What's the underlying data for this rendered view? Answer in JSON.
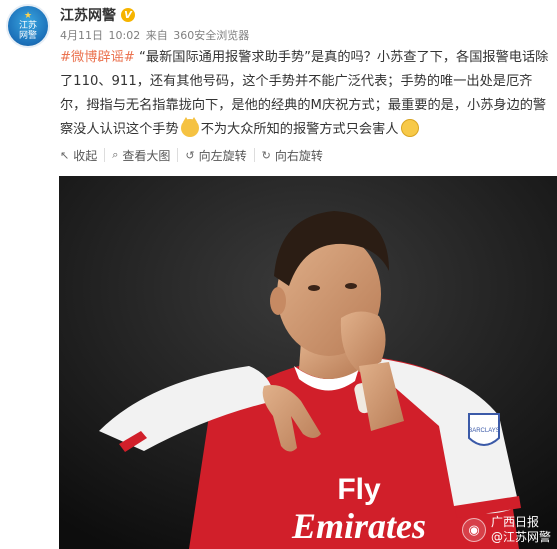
{
  "account": {
    "avatar_lines": [
      "江苏",
      "网警"
    ],
    "name": "江苏网警",
    "verified_mark": "V"
  },
  "meta": {
    "date": "4月11日",
    "time": "10:02",
    "via_prefix": "来自",
    "client": "360安全浏览器"
  },
  "post": {
    "hashtag": "#微博辟谣#",
    "text_1": " “最新国际通用报警求助手势”是真的吗？小苏查了下，各国报警电话除了110、911，还有其他号码，这个手势并不能广泛代表；手势的唯一出处是厄齐尔，拇指与无名指靠拢向下，是他的经典的M庆祝方式；最重要的是，小苏身边的警察没人认识这个手势",
    "text_2": "不为大众所知的报警方式只会害人",
    "emoji_1": "cat-face-emoji",
    "emoji_2": "thinking-emoji"
  },
  "toolbar": [
    {
      "icon": "↖",
      "label": "收起"
    },
    {
      "icon": "⌕",
      "label": "查看大图"
    },
    {
      "icon": "↺",
      "label": "向左旋转"
    },
    {
      "icon": "↻",
      "label": "向右旋转"
    }
  ],
  "photo": {
    "shirt_sponsor_1": "Fly",
    "shirt_sponsor_2": "Emirates",
    "sleeve_badge": "BARCLAYS"
  },
  "watermark": {
    "line1": "广西日报",
    "line2": "@江苏网警"
  },
  "colors": {
    "hashtag": "#eb7350",
    "meta_gray": "#808080",
    "jersey_red": "#d11f2a"
  }
}
